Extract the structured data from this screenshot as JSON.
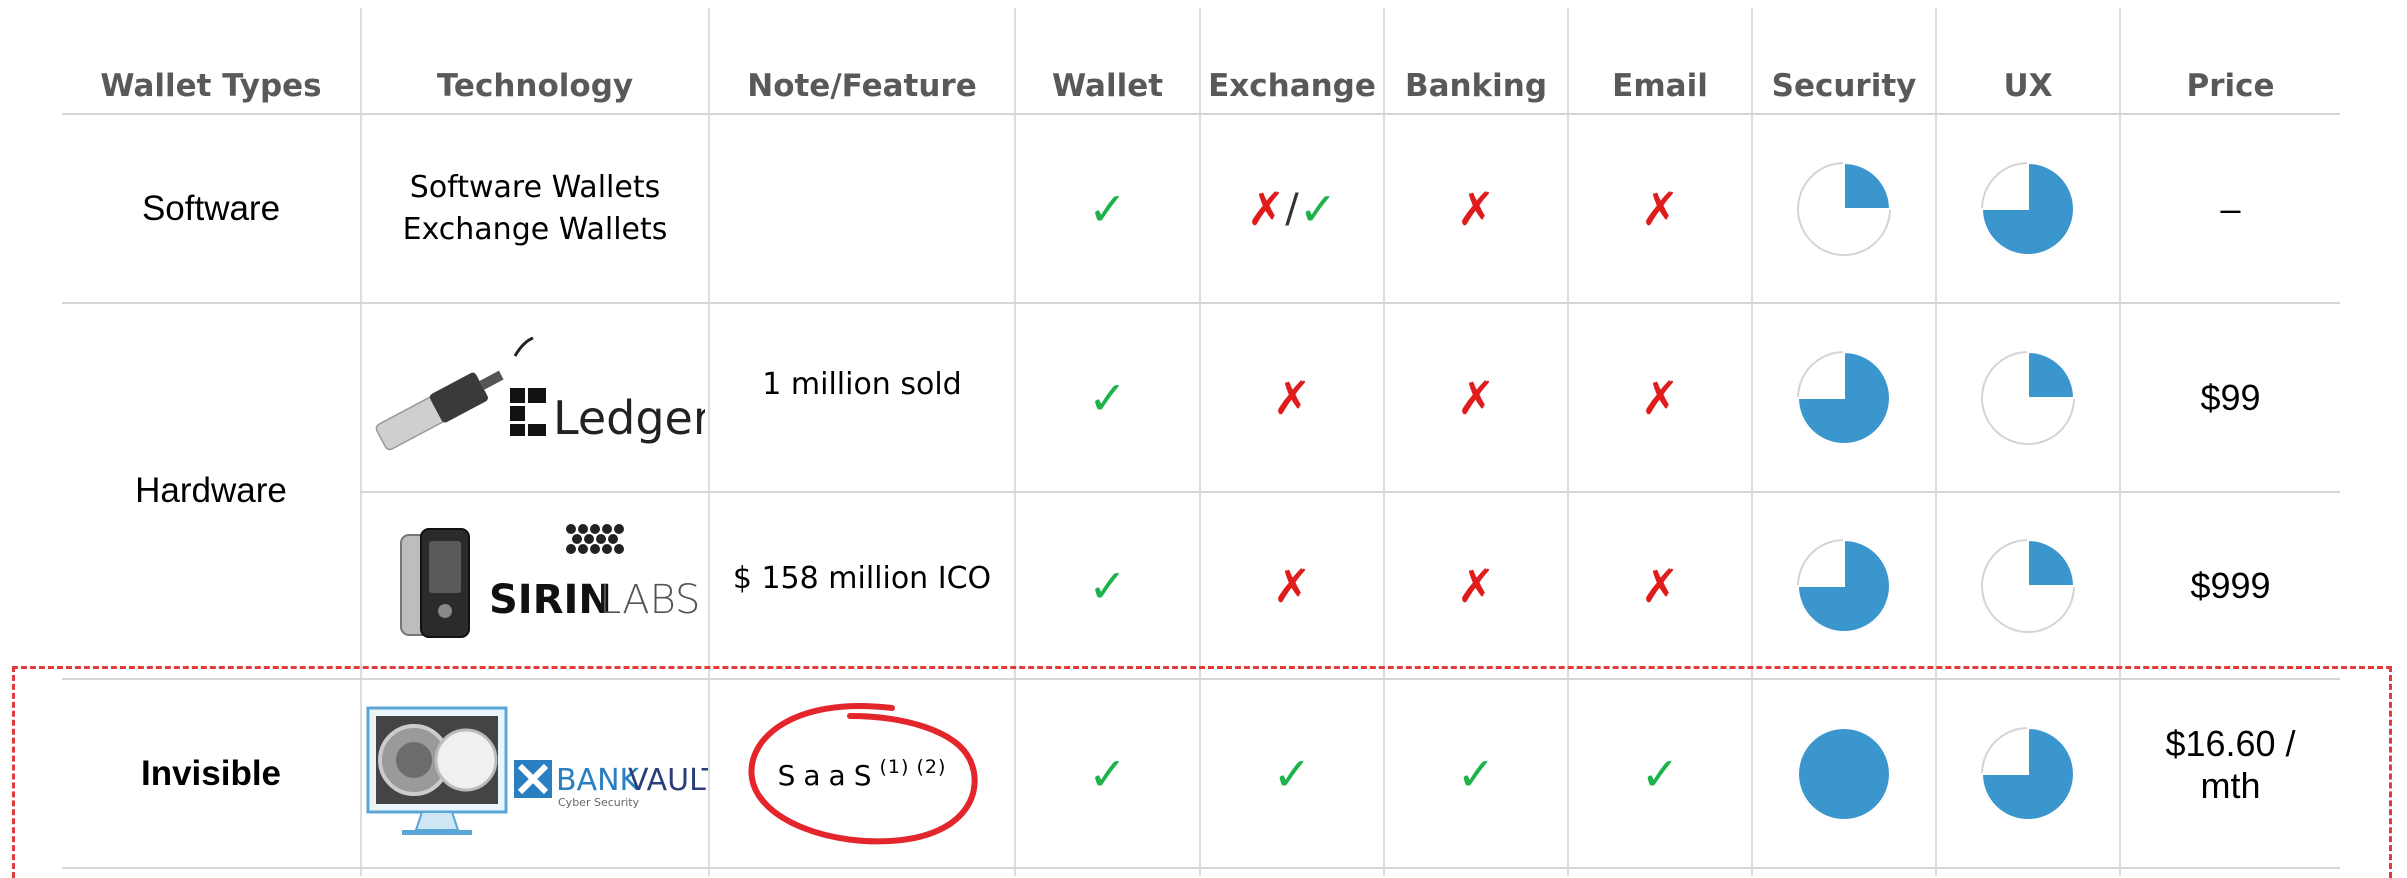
{
  "columns": [
    "Wallet Types",
    "Technology",
    "Note/Feature",
    "Wallet",
    "Exchange",
    "Banking",
    "Email",
    "Security",
    "UX",
    "Price"
  ],
  "rows": {
    "software": {
      "type": "Software",
      "tech_line1": "Software Wallets",
      "tech_line2": "Exchange Wallets",
      "note": "",
      "wallet": "✓",
      "exchange_cross": "✗",
      "exchange_sep": "/",
      "exchange_check": "✓",
      "banking": "✗",
      "email": "✗",
      "security_fraction": 0.25,
      "ux_fraction": 0.75,
      "price": "–"
    },
    "hardware": {
      "type": "Hardware",
      "ledger": {
        "logo_text": "Ledger",
        "note": "1 million sold",
        "wallet": "✓",
        "exchange": "✗",
        "banking": "✗",
        "email": "✗",
        "security_fraction": 0.75,
        "ux_fraction": 0.25,
        "price": "$99"
      },
      "sirin": {
        "logo_bold": "SIRIN",
        "logo_light": "LABS",
        "note": "$ 158 million ICO",
        "wallet": "✓",
        "exchange": "✗",
        "banking": "✗",
        "email": "✗",
        "security_fraction": 0.75,
        "ux_fraction": 0.25,
        "price": "$999"
      }
    },
    "invisible": {
      "type": "Invisible",
      "logo_bank": "BANK",
      "logo_vault": "VAULT.",
      "logo_sub": "Cyber Security",
      "note_main": "SaaS",
      "note_refs": "(1) (2)",
      "wallet": "✓",
      "exchange": "✓",
      "banking": "✓",
      "email": "✓",
      "security_fraction": 1.0,
      "ux_fraction": 0.75,
      "price_line1": "$16.60 /",
      "price_line2": "mth"
    }
  },
  "colors": {
    "pie_fill": "#3a96cc",
    "check": "#1db24a",
    "cross": "#e01b1b",
    "highlight": "#e23b3b"
  }
}
